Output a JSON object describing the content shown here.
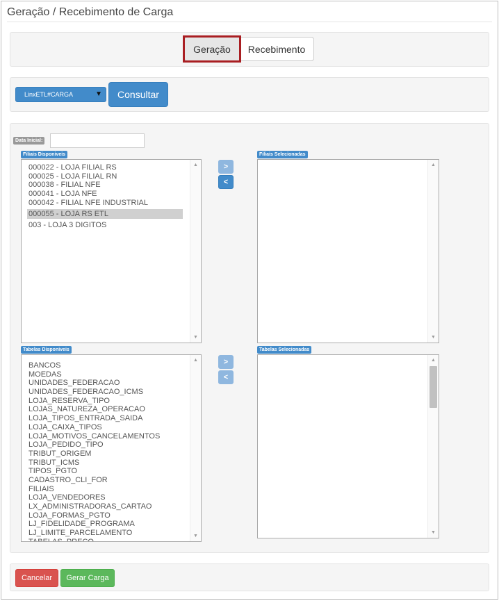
{
  "page": {
    "title": "Geração / Recebimento de Carga"
  },
  "tabs": {
    "geracao": "Geração",
    "recebimento": "Recebimento"
  },
  "query": {
    "database_selected": "LinxETL#CARGA",
    "consultar_label": "Consultar"
  },
  "filters": {
    "data_inicial_label": "Data Inicial:",
    "data_inicial_value": ""
  },
  "filiais": {
    "available_label": "Filiais Disponiveis",
    "selected_label": "Filiais Selecionadas",
    "available": [
      "000022 - LOJA FILIAL RS",
      "000025 - LOJA FILIAL RN",
      "000038 - FILIAL NFE",
      "000041 - LOJA NFE",
      "000042 - FILIAL NFE INDUSTRIAL",
      "000055 - LOJA RS ETL",
      "003 - LOJA 3 DIGITOS"
    ],
    "highlighted": "000055 - LOJA RS ETL"
  },
  "tabelas": {
    "available_label": "Tabelas Disponiveis",
    "selected_label": "Tabelas Selecionadas",
    "available": [
      "BANCOS",
      "MOEDAS",
      "UNIDADES_FEDERACAO",
      "UNIDADES_FEDERACAO_ICMS",
      "LOJA_RESERVA_TIPO",
      "LOJAS_NATUREZA_OPERACAO",
      "LOJA_TIPOS_ENTRADA_SAIDA",
      "LOJA_CAIXA_TIPOS",
      "LOJA_MOTIVOS_CANCELAMENTOS",
      "LOJA_PEDIDO_TIPO",
      "TRIBUT_ORIGEM",
      "TRIBUT_ICMS",
      "TIPOS_PGTO",
      "CADASTRO_CLI_FOR",
      "FILIAIS",
      "LOJA_VENDEDORES",
      "LX_ADMINISTRADORAS_CARTAO",
      "LOJA_FORMAS_PGTO",
      "LJ_FIDELIDADE_PROGRAMA",
      "LJ_LIMITE_PARCELAMENTO",
      "TABELAS_PRECO"
    ]
  },
  "move": {
    "add": ">",
    "remove": "<"
  },
  "icons": {
    "dropdown": "caret-down-icon",
    "scroll_up": "scroll-up-icon",
    "scroll_down": "scroll-down-icon"
  },
  "actions": {
    "cancel_label": "Cancelar",
    "gerar_label": "Gerar Carga"
  },
  "colors": {
    "primary": "#428bca",
    "danger": "#d9534f",
    "success": "#5cb85c",
    "highlight_border": "#a91e22"
  }
}
